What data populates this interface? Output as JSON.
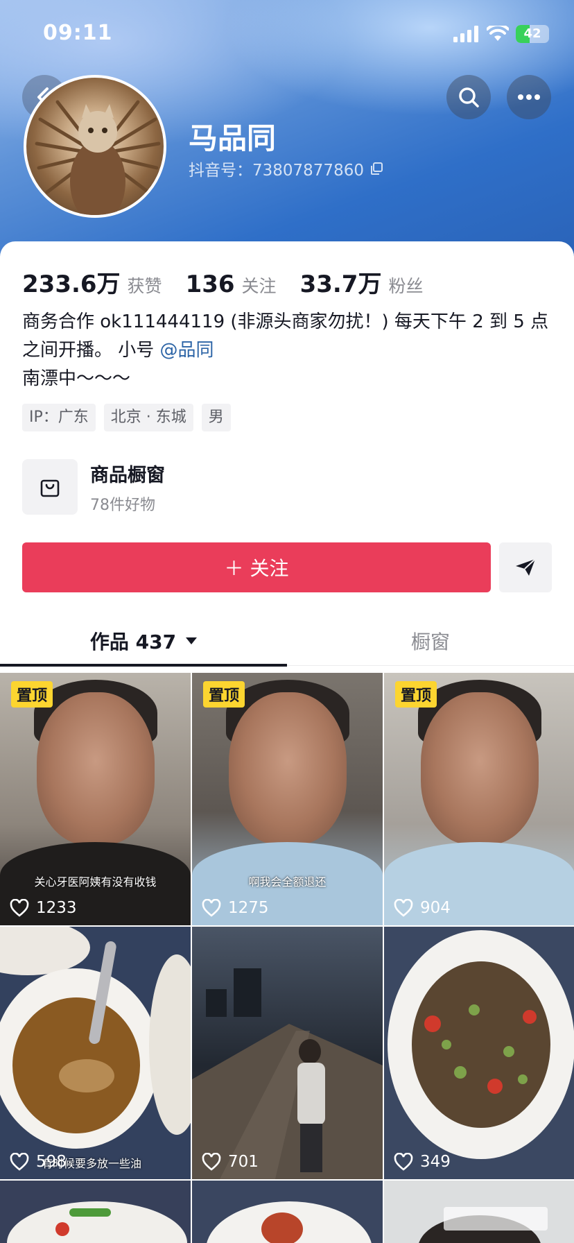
{
  "status_bar": {
    "time": "09:11",
    "battery": "42",
    "battery_level": 0.42
  },
  "profile": {
    "nickname": "马品同",
    "douyin_id": "抖音号：73807877860",
    "stats": [
      {
        "value": "233.6万",
        "label": "获赞"
      },
      {
        "value": "136",
        "label": "关注"
      },
      {
        "value": "33.7万",
        "label": "粉丝"
      }
    ],
    "bio_line1": "商务合作 ok111444119 (非源头商家勿扰！) 每天下午 2 到 5 点",
    "bio_line2_prefix": "之间开播。 小号 ",
    "bio_mention": "@品同",
    "bio_line3": "南漂中～～～",
    "tags": [
      "IP：广东",
      "北京 · 东城",
      "男"
    ]
  },
  "shop": {
    "title": "商品橱窗",
    "subtitle": "78件好物"
  },
  "actions": {
    "follow_label": "＋ 关注"
  },
  "tabs": {
    "works": "作品 437",
    "showcase": "橱窗"
  },
  "pin_label": "置顶",
  "videos": [
    {
      "likes": "1233",
      "caption": "关心牙医阿姨有没有收钱",
      "pinned": true
    },
    {
      "likes": "1275",
      "caption": "啊我会全额退还",
      "pinned": true
    },
    {
      "likes": "904",
      "caption": "",
      "pinned": true
    },
    {
      "likes": "598",
      "caption": "有时候要多放一些油",
      "pinned": false
    },
    {
      "likes": "701",
      "caption": "",
      "pinned": false
    },
    {
      "likes": "349",
      "caption": "",
      "pinned": false
    }
  ],
  "colors": {
    "accent": "#ea3d5a",
    "pin": "#fcd530",
    "mention": "#2c64a6"
  }
}
